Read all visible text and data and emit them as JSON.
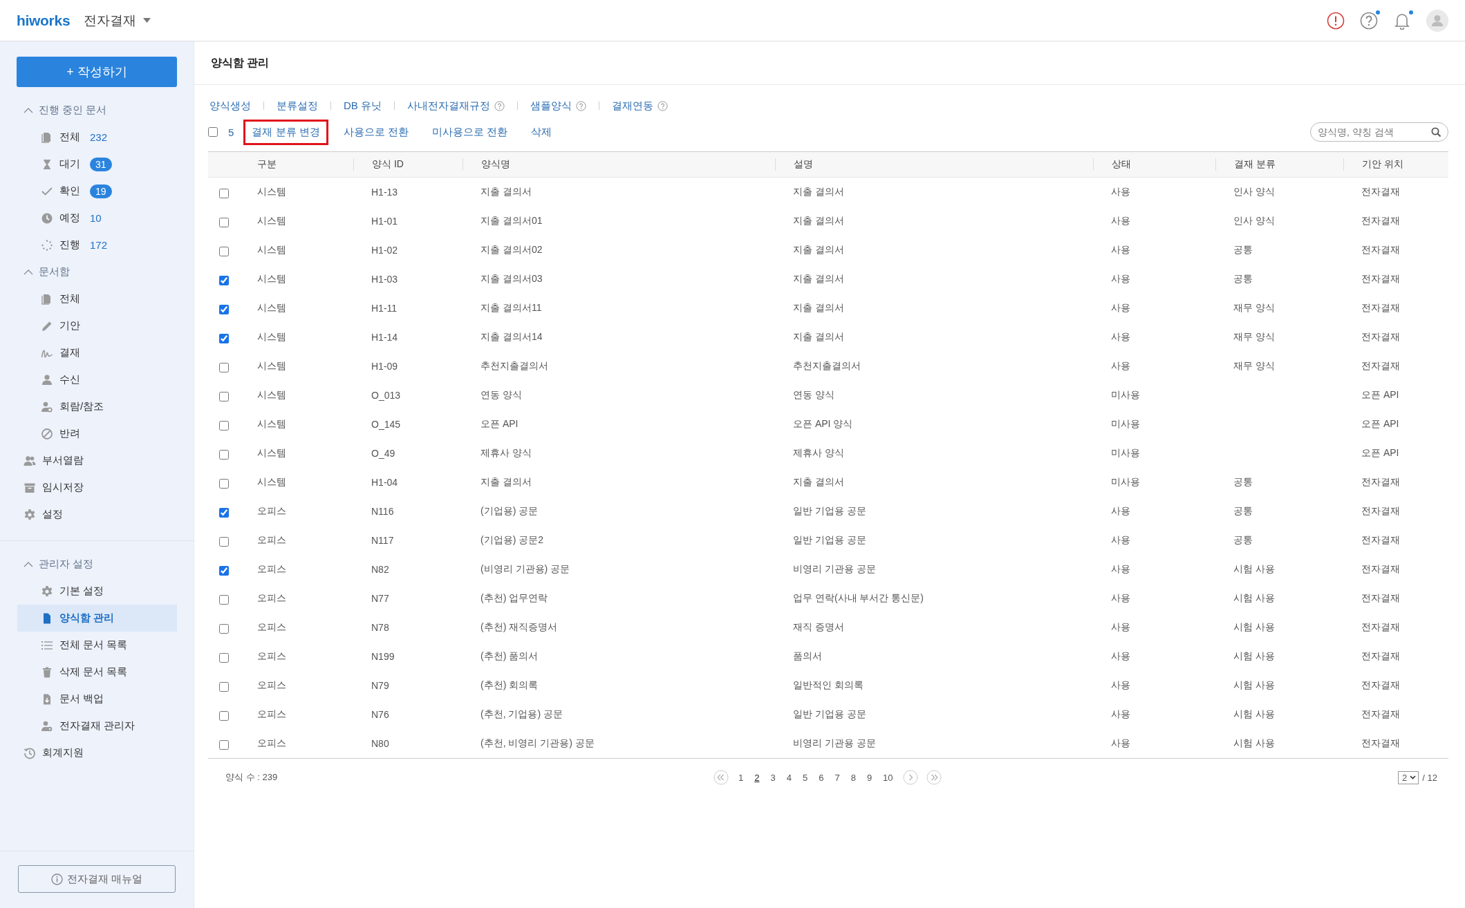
{
  "header": {
    "logo": "hiworks",
    "app_menu": "전자결재",
    "icons": [
      {
        "kind": "alert"
      },
      {
        "kind": "help",
        "dot": true
      },
      {
        "kind": "bell",
        "dot": true
      },
      {
        "kind": "avatar"
      }
    ]
  },
  "sidebar": {
    "compose_button": "+ 작성하기",
    "sections": [
      {
        "kind": "group",
        "label": "진행 중인 문서",
        "expanded": true,
        "children": [
          {
            "label": "전체",
            "count": "232",
            "badge": false,
            "selected": false
          },
          {
            "label": "대기",
            "count": "31",
            "badge": true,
            "selected": false
          },
          {
            "label": "확인",
            "count": "19",
            "badge": true,
            "selected": false
          },
          {
            "label": "예정",
            "count": "10",
            "badge": false,
            "selected": false
          },
          {
            "label": "진행",
            "count": "172",
            "badge": false,
            "selected": false
          }
        ]
      },
      {
        "kind": "group",
        "label": "문서함",
        "expanded": true,
        "children": [
          {
            "label": "전체",
            "selected": false
          },
          {
            "label": "기안",
            "selected": false
          },
          {
            "label": "결재",
            "selected": false
          },
          {
            "label": "수신",
            "selected": false
          },
          {
            "label": "회람/참조",
            "selected": false
          },
          {
            "label": "반려",
            "selected": false
          }
        ]
      },
      {
        "kind": "link",
        "label": "부서열람",
        "selected": false
      },
      {
        "kind": "link",
        "label": "임시저장",
        "selected": false
      },
      {
        "kind": "link",
        "label": "설정",
        "selected": false
      },
      {
        "kind": "divider"
      },
      {
        "kind": "group",
        "label": "관리자 설정",
        "expanded": true,
        "children": [
          {
            "label": "기본 설정",
            "selected": false
          },
          {
            "label": "양식함 관리",
            "selected": true
          },
          {
            "label": "전체 문서 목록",
            "selected": false
          },
          {
            "label": "삭제 문서 목록",
            "selected": false
          },
          {
            "label": "문서 백업",
            "selected": false
          },
          {
            "label": "전자결재 관리자",
            "selected": false
          }
        ]
      },
      {
        "kind": "link",
        "label": "회계지원",
        "selected": false
      }
    ],
    "manual_button": "전자결재 매뉴얼"
  },
  "page_title": "양식함 관리",
  "tabs": [
    {
      "label": "양식생성",
      "help": false
    },
    {
      "label": "분류설정",
      "help": false
    },
    {
      "label": "DB 유닛",
      "help": false
    },
    {
      "label": "사내전자결재규정",
      "help": true
    },
    {
      "label": "샘플양식",
      "help": true
    },
    {
      "label": "결재연동",
      "help": true
    }
  ],
  "actions": {
    "select_all": false,
    "selected_count": "5",
    "items": [
      {
        "label": "결재 분류 변경",
        "highlighted": true
      },
      {
        "label": "사용으로 전환",
        "highlighted": false
      },
      {
        "label": "미사용으로 전환",
        "highlighted": false
      },
      {
        "label": "삭제",
        "highlighted": false
      }
    ],
    "search": {
      "placeholder": "양식명, 약칭 검색"
    }
  },
  "table": {
    "columns": [
      "구분",
      "양식 ID",
      "양식명",
      "설명",
      "상태",
      "결재 분류",
      "기안 위치"
    ],
    "rows": [
      {
        "checked": false,
        "cells": [
          "시스템",
          "H1-13",
          "지출 결의서",
          "지출 결의서",
          "사용",
          "인사 양식",
          "전자결재"
        ]
      },
      {
        "checked": false,
        "cells": [
          "시스템",
          "H1-01",
          "지출 결의서01",
          "지출 결의서",
          "사용",
          "인사 양식",
          "전자결재"
        ]
      },
      {
        "checked": false,
        "cells": [
          "시스템",
          "H1-02",
          "지출 결의서02",
          "지출 결의서",
          "사용",
          "공통",
          "전자결재"
        ]
      },
      {
        "checked": true,
        "cells": [
          "시스템",
          "H1-03",
          "지출 결의서03",
          "지출 결의서",
          "사용",
          "공통",
          "전자결재"
        ]
      },
      {
        "checked": true,
        "cells": [
          "시스템",
          "H1-11",
          "지출 결의서11",
          "지출 결의서",
          "사용",
          "재무 양식",
          "전자결재"
        ]
      },
      {
        "checked": true,
        "cells": [
          "시스템",
          "H1-14",
          "지출 결의서14",
          "지출 결의서",
          "사용",
          "재무 양식",
          "전자결재"
        ]
      },
      {
        "checked": false,
        "cells": [
          "시스템",
          "H1-09",
          "추천지출결의서",
          "추천지출결의서",
          "사용",
          "재무 양식",
          "전자결재"
        ]
      },
      {
        "checked": false,
        "cells": [
          "시스템",
          "O_013",
          "연동 양식",
          "연동 양식",
          "미사용",
          "",
          "오픈 API"
        ]
      },
      {
        "checked": false,
        "cells": [
          "시스템",
          "O_145",
          "오픈 API",
          "오픈 API 양식",
          "미사용",
          "",
          "오픈 API"
        ]
      },
      {
        "checked": false,
        "cells": [
          "시스템",
          "O_49",
          "제휴사 양식",
          "제휴사 양식",
          "미사용",
          "",
          "오픈 API"
        ]
      },
      {
        "checked": false,
        "cells": [
          "시스템",
          "H1-04",
          "지출 결의서",
          "지출 결의서",
          "미사용",
          "공통",
          "전자결재"
        ]
      },
      {
        "checked": true,
        "cells": [
          "오피스",
          "N116",
          "(기업용) 공문",
          "일반 기업용 공문",
          "사용",
          "공통",
          "전자결재"
        ]
      },
      {
        "checked": false,
        "cells": [
          "오피스",
          "N117",
          "(기업용) 공문2",
          "일반 기업용 공문",
          "사용",
          "공통",
          "전자결재"
        ]
      },
      {
        "checked": true,
        "cells": [
          "오피스",
          "N82",
          "(비영리 기관용) 공문",
          "비영리 기관용 공문",
          "사용",
          "시험 사용",
          "전자결재"
        ]
      },
      {
        "checked": false,
        "cells": [
          "오피스",
          "N77",
          "(추천) 업무연락",
          "업무 연락(사내 부서간 통신문)",
          "사용",
          "시험 사용",
          "전자결재"
        ]
      },
      {
        "checked": false,
        "cells": [
          "오피스",
          "N78",
          "(추천) 재직증명서",
          "재직 증명서",
          "사용",
          "시험 사용",
          "전자결재"
        ]
      },
      {
        "checked": false,
        "cells": [
          "오피스",
          "N199",
          "(추천) 품의서",
          "품의서",
          "사용",
          "시험 사용",
          "전자결재"
        ]
      },
      {
        "checked": false,
        "cells": [
          "오피스",
          "N79",
          "(추천) 회의록",
          "일반적인 회의록",
          "사용",
          "시험 사용",
          "전자결재"
        ]
      },
      {
        "checked": false,
        "cells": [
          "오피스",
          "N76",
          "(추천, 기업용) 공문",
          "일반 기업용 공문",
          "사용",
          "시험 사용",
          "전자결재"
        ]
      },
      {
        "checked": false,
        "cells": [
          "오피스",
          "N80",
          "(추천, 비영리 기관용) 공문",
          "비영리 기관용 공문",
          "사용",
          "시험 사용",
          "전자결재"
        ]
      }
    ]
  },
  "footer": {
    "count_label": "양식 수 : 239",
    "pages": [
      {
        "label": "1",
        "selected": false
      },
      {
        "label": "2",
        "selected": true
      },
      {
        "label": "3",
        "selected": false
      },
      {
        "label": "4",
        "selected": false
      },
      {
        "label": "5",
        "selected": false
      },
      {
        "label": "6",
        "selected": false
      },
      {
        "label": "7",
        "selected": false
      },
      {
        "label": "8",
        "selected": false
      },
      {
        "label": "9",
        "selected": false
      },
      {
        "label": "10",
        "selected": false
      }
    ],
    "page_select": "2",
    "total_pages": "/ 12"
  }
}
